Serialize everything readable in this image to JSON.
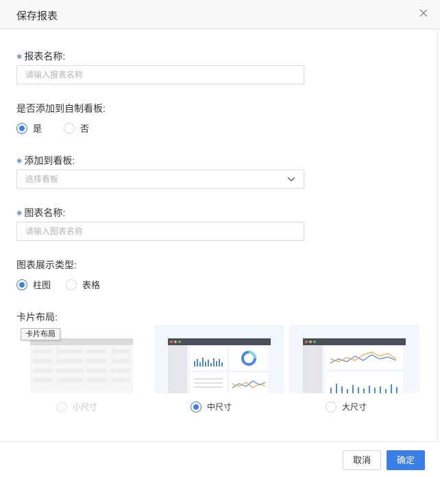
{
  "dialog": {
    "title": "保存报表",
    "close_icon": "close-icon"
  },
  "form": {
    "report_name": {
      "label": "报表名称:",
      "placeholder": "请输入报表名称",
      "required": true
    },
    "add_to_board": {
      "label": "是否添加到自制看板:",
      "options": [
        "是",
        "否"
      ],
      "selected": "是"
    },
    "board": {
      "label": "添加到看板:",
      "placeholder": "选择看板",
      "required": true
    },
    "chart_name": {
      "label": "图表名称:",
      "placeholder": "请输入图表名称",
      "required": true
    },
    "chart_type": {
      "label": "图表展示类型:",
      "options": [
        "柱图",
        "表格"
      ],
      "selected": "柱图"
    },
    "card_layout": {
      "label": "卡片布局:",
      "tooltip": "卡片布局",
      "options": [
        "小尺寸",
        "中尺寸",
        "大尺寸"
      ],
      "selected": "中尺寸",
      "disabled": [
        "小尺寸"
      ]
    }
  },
  "footer": {
    "cancel_label": "取消",
    "ok_label": "确定"
  },
  "colors": {
    "accent": "#3a7ee6",
    "required_star": "#7a93c9",
    "thumb_bg": "#f3f7fd",
    "thumb_header": "#4a4f5b"
  }
}
